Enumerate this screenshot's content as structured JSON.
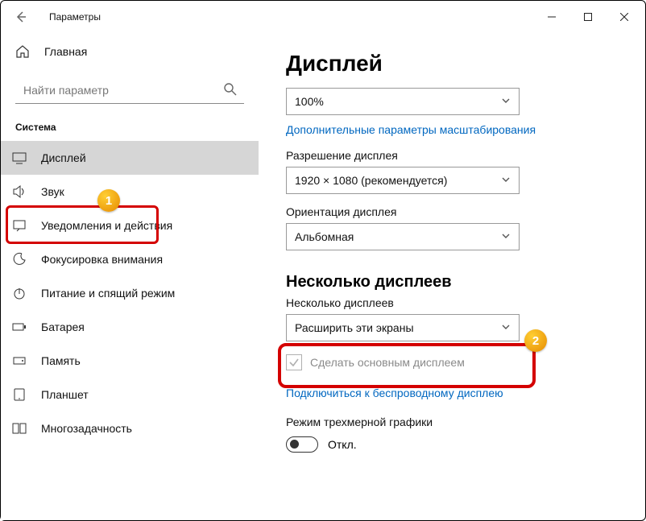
{
  "window": {
    "title": "Параметры"
  },
  "sidebar": {
    "home_label": "Главная",
    "search_placeholder": "Найти параметр",
    "group_label": "Система",
    "items": [
      {
        "label": "Дисплей"
      },
      {
        "label": "Звук"
      },
      {
        "label": "Уведомления и действия"
      },
      {
        "label": "Фокусировка внимания"
      },
      {
        "label": "Питание и спящий режим"
      },
      {
        "label": "Батарея"
      },
      {
        "label": "Память"
      },
      {
        "label": "Планшет"
      },
      {
        "label": "Многозадачность"
      }
    ]
  },
  "main": {
    "heading": "Дисплей",
    "scale_value": "100%",
    "advanced_scaling_link": "Дополнительные параметры масштабирования",
    "resolution_label": "Разрешение дисплея",
    "resolution_value": "1920 × 1080 (рекомендуется)",
    "orientation_label": "Ориентация дисплея",
    "orientation_value": "Альбомная",
    "multi_heading": "Несколько дисплеев",
    "multi_label": "Несколько дисплеев",
    "multi_value": "Расширить эти экраны",
    "make_primary_label": "Сделать основным дисплеем",
    "wireless_link": "Подключиться к беспроводному дисплею",
    "gfx_label": "Режим трехмерной графики",
    "toggle_off": "Откл."
  },
  "annotations": {
    "b1": "1",
    "b2": "2"
  }
}
